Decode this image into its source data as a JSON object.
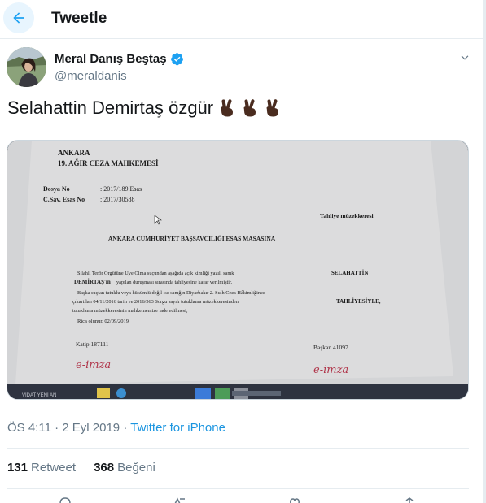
{
  "header": {
    "title": "Tweetle"
  },
  "author": {
    "name": "Meral Danış Beştaş",
    "handle": "@meraldanis"
  },
  "tweet": {
    "text": "Selahattin Demirtaş özgür",
    "emoji": [
      "✌🏿",
      "✌🏿",
      "✌🏿"
    ]
  },
  "document": {
    "city": "ANKARA",
    "court": "19. AĞIR CEZA MAHKEMESİ",
    "dosya_label": "Dosya No",
    "dosya_value": ": 2017/189 Esas",
    "csav_label": "C.Sav. Esas No",
    "csav_value": ": 2017/30588",
    "doc_type": "Tahliye müzekkeresi",
    "addressee": "ANKARA CUMHURİYET BAŞSAVCILIĞI ESAS MASASINA",
    "body1a": "Silahlı Terör Örgütüne Üye Olma suçundan aşağıda açık kimliği yazılı sanık",
    "body1b": "SELAHATTİN",
    "body2a": "DEMİRTAŞ'ın",
    "body2b": "yapılan duruşması sırasında tahliyesine karar verilmiştir.",
    "body3": "Başka suçtan tutuklu veya hükümlü değil ise sanığın Diyarbakır 2. Sulh Ceza Hâkimliğince",
    "body4": "çıkartılan 04/11/2016 tarih ve 2016/563 Sorgu sayılı tutuklama müzekkeresinden",
    "body4b": "TAHLİYESİYLE,",
    "body5": "tutuklama müzekkeresinin mahkememize iade edilmesi,",
    "body6": "Rica olunur. 02/09/2019",
    "katip": "Katip 187111",
    "baskan": "Başkan 41097",
    "imza": "e-imza",
    "taskbar_text": "VİDAT YENİ AN"
  },
  "meta": {
    "time": "ÖS 4:11",
    "separator": "·",
    "date": "2 Eyl 2019",
    "source": "Twitter for iPhone"
  },
  "stats": {
    "retweets_count": "131",
    "retweets_label": "Retweet",
    "likes_count": "368",
    "likes_label": "Beğeni"
  },
  "colors": {
    "accent": "#1da1f2",
    "link": "#1b95e0",
    "verified": "#1da1f2",
    "muted": "#657786",
    "skin": "#4a2c1f"
  }
}
